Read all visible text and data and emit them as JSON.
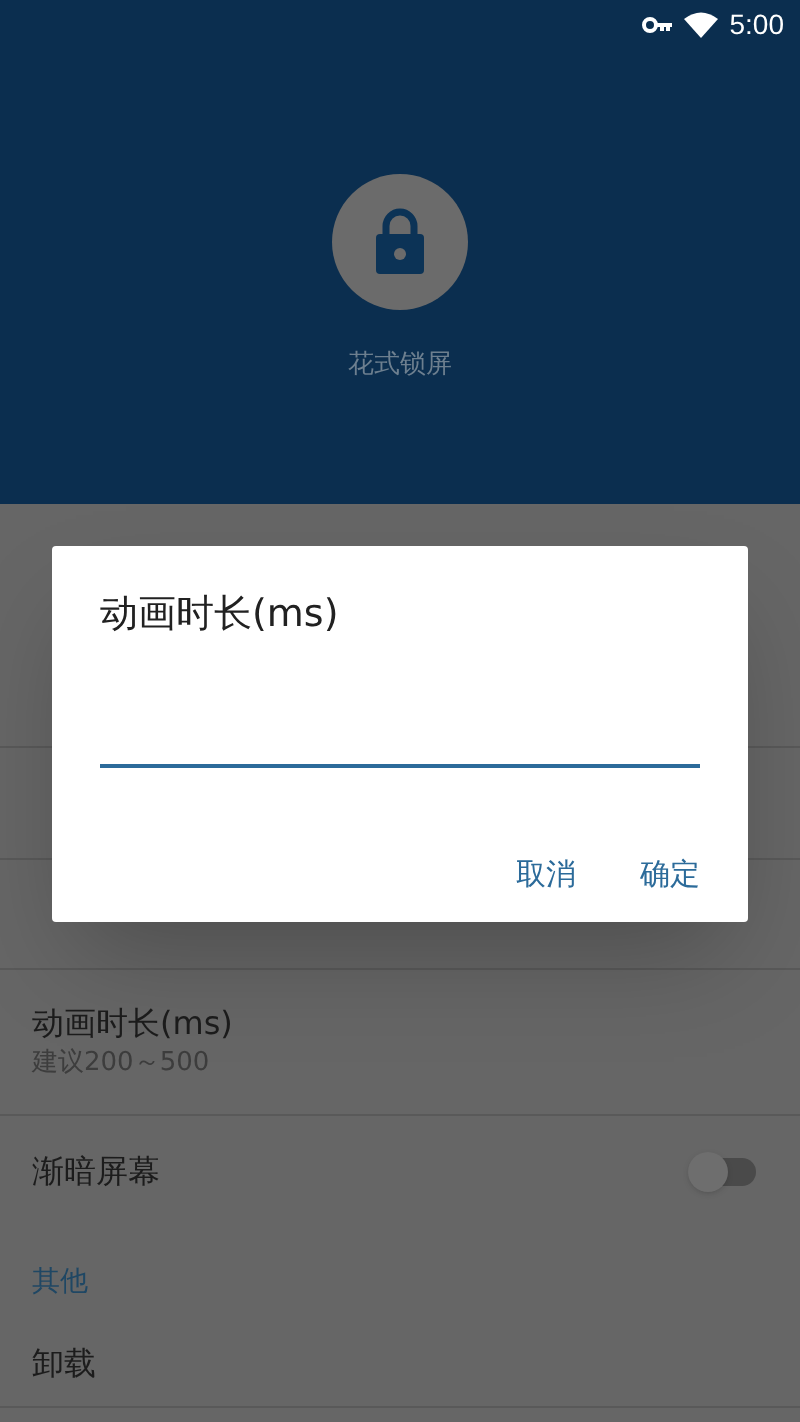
{
  "status_bar": {
    "time": "5:00"
  },
  "header": {
    "app_name": "花式锁屏"
  },
  "settings": [
    {
      "kind": "item"
    },
    {
      "kind": "section"
    },
    {
      "kind": "item"
    },
    {
      "kind": "item"
    },
    {
      "kind": "item"
    },
    {
      "kind": "item",
      "title": "动画时长(ms)",
      "subtitle": "建议200～500"
    },
    {
      "kind": "toggle",
      "title": "渐暗屏幕",
      "on": false
    },
    {
      "kind": "section",
      "title": "其他"
    },
    {
      "kind": "item",
      "title": "卸载"
    }
  ],
  "dialog": {
    "title": "动画时长(ms)",
    "buttons": [
      "取消",
      "确定"
    ]
  }
}
